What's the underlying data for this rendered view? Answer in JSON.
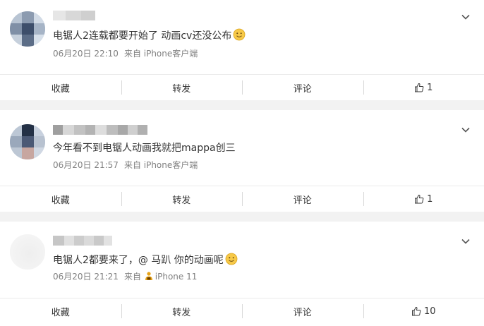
{
  "posts": [
    {
      "text": "电锯人2连载都要开始了 动画cv还没公布",
      "date": "06月20日 22:10",
      "source": "来自 iPhone客户端",
      "actions": {
        "collect": "收藏",
        "forward": "转发",
        "comment": "评论",
        "like_count": "1"
      },
      "has_emoji": true,
      "source_badge": false
    },
    {
      "text": "今年看不到电锯人动画我就把mappa创三",
      "date": "06月20日 21:57",
      "source": "来自 iPhone客户端",
      "actions": {
        "collect": "收藏",
        "forward": "转发",
        "comment": "评论",
        "like_count": "1"
      },
      "has_emoji": false,
      "source_badge": false
    },
    {
      "text": "电锯人2都要来了，@ 马趴 你的动画呢",
      "date": "06月20日 21:21",
      "source_prefix": "来自",
      "source": "iPhone 11",
      "actions": {
        "collect": "收藏",
        "forward": "转发",
        "comment": "评论",
        "like_count": "10"
      },
      "has_emoji": true,
      "source_badge": true
    }
  ],
  "colors": {
    "text": "#333333",
    "meta": "#808080",
    "divider": "#eaeaea",
    "background": "#f2f2f2",
    "emoji": "#f7c948"
  },
  "icons": {
    "more": "chevron-down-icon",
    "like": "thumbs-up-icon",
    "emoji": "smile-emoji-icon",
    "badge": "iphone-badge-icon"
  }
}
